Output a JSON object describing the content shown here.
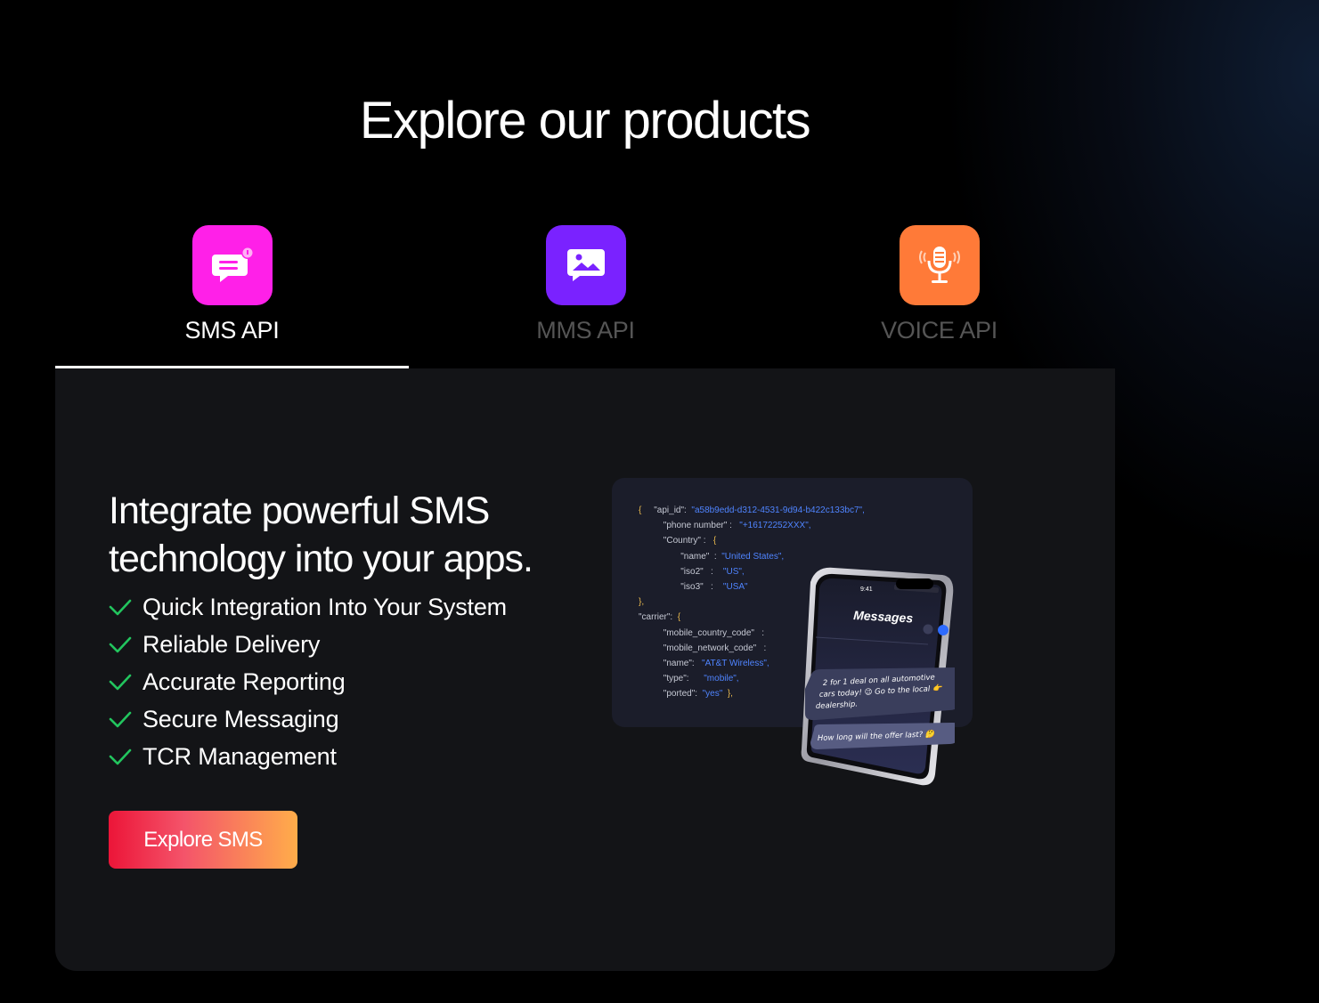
{
  "heading": "Explore our products",
  "tabs": [
    {
      "label": "SMS API",
      "icon": "chat-message-icon",
      "color": "#ff20e8",
      "active": true
    },
    {
      "label": "MMS API",
      "icon": "image-message-icon",
      "color": "#7a22ff",
      "active": false
    },
    {
      "label": "VOICE API",
      "icon": "microphone-icon",
      "color": "#ff7a38",
      "active": false
    }
  ],
  "panel": {
    "headline": "Integrate powerful SMS technology into your apps.",
    "features": [
      "Quick Integration Into Your System",
      "Reliable Delivery",
      "Accurate Reporting",
      "Secure Messaging",
      "TCR Management"
    ],
    "cta_label": "Explore SMS",
    "check_color": "#22c55e"
  },
  "code_sample": {
    "api_id_key": "\"api_id\":",
    "api_id_val": "\"a58b9edd-d312-4531-9d94-b422c133bc7\",",
    "phone_key": "\"phone number\" :",
    "phone_val": "\"+16172252XXX\",",
    "country_key": "\"Country\" :",
    "name_key": "\"name\"  :",
    "name_val": "\"United States\",",
    "iso2_key": "\"iso2\"   :",
    "iso2_val": "\"US\",",
    "iso3_key": "\"iso3\"   :",
    "iso3_val": "\"USA\"",
    "carrier_key": "\"carrier\":",
    "mcc_key": "\"mobile_country_code\"   :",
    "mnc_key": "\"mobile_network_code\"   :",
    "cname_key": "\"name\":",
    "cname_val": "\"AT&T Wireless\",",
    "type_key": "\"type\":",
    "type_val": "\"mobile\",",
    "ported_key": "\"ported\":",
    "ported_val": "\"yes\""
  },
  "phone": {
    "time": "9:41",
    "app_title": "Messages",
    "message_1_line_1": "2 for 1 deal on all automotive",
    "message_1_line_2": "cars today! 😉 Go to the local 👉",
    "message_1_line_3": "dealership.",
    "message_2": "How long will the offer last? 🤔"
  }
}
